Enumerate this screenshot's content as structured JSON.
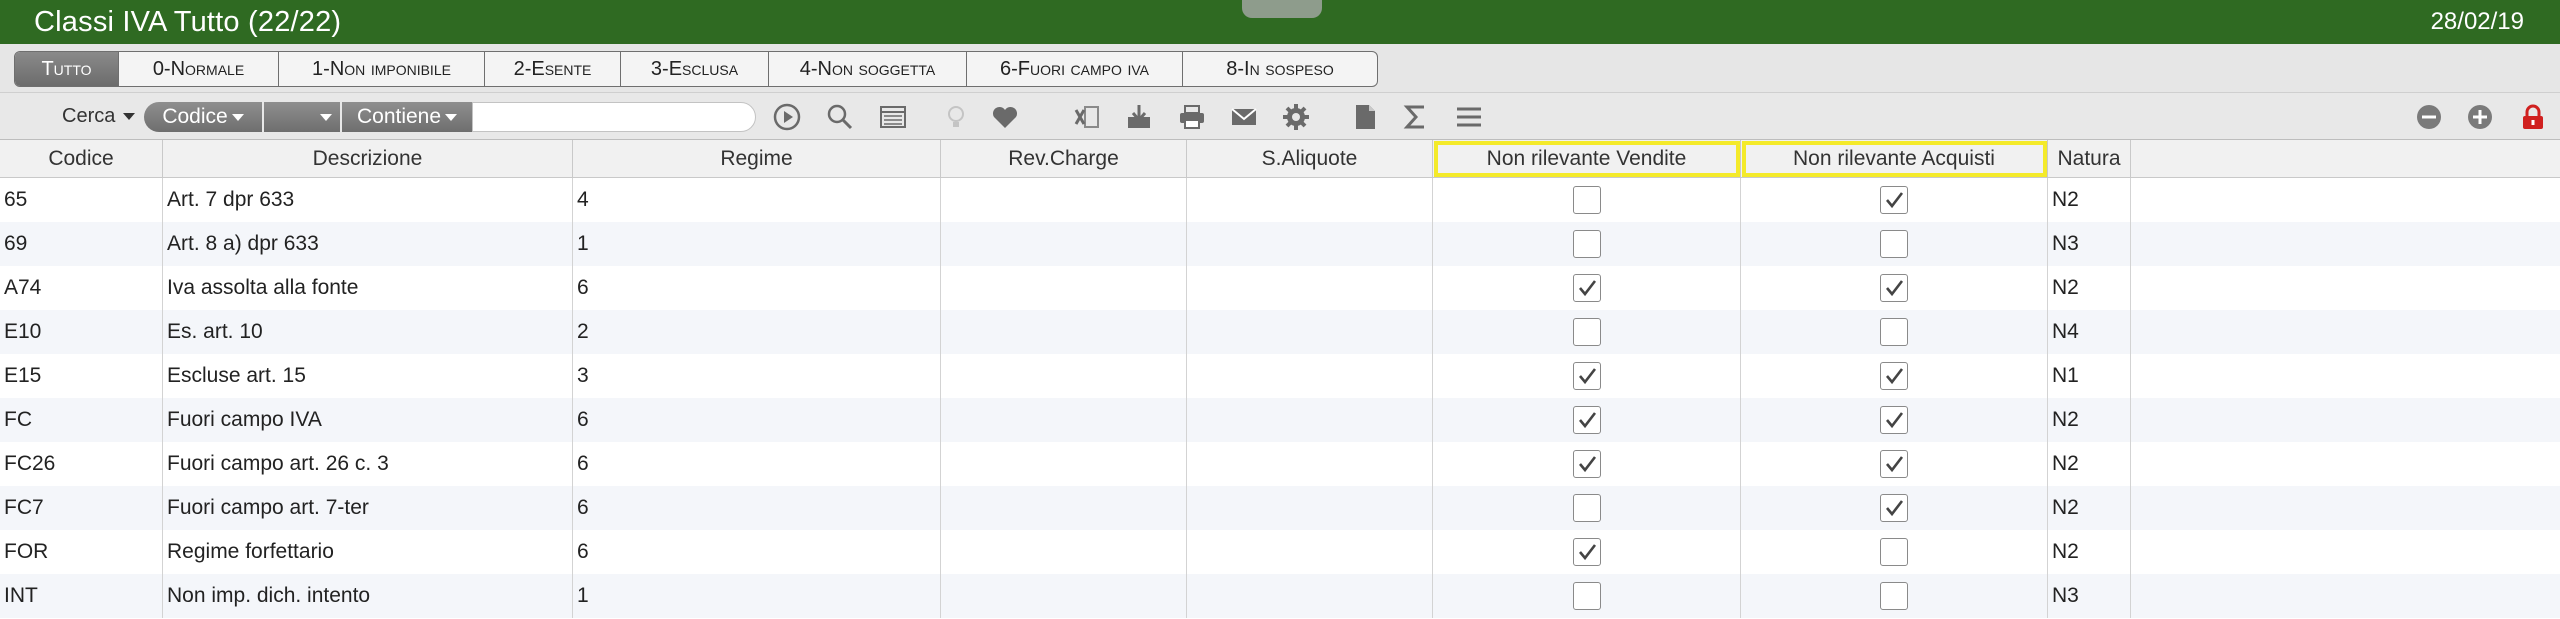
{
  "window": {
    "title": "Classi IVA Tutto (22/22)",
    "date": "28/02/19"
  },
  "tabs": [
    {
      "label": "Tutto",
      "active": true
    },
    {
      "label": "0-Normale",
      "active": false
    },
    {
      "label": "1-Non imponibile",
      "active": false
    },
    {
      "label": "2-Esente",
      "active": false
    },
    {
      "label": "3-Esclusa",
      "active": false
    },
    {
      "label": "4-Non soggetta",
      "active": false
    },
    {
      "label": "6-Fuori campo iva",
      "active": false
    },
    {
      "label": "8-In sospeso",
      "active": false
    }
  ],
  "toolbar": {
    "cerca_label": "Cerca",
    "field_select": "Codice",
    "blank_select": "",
    "operator_select": "Contiene",
    "search_value": "",
    "icons": [
      "play-icon",
      "search-icon",
      "list-view-icon",
      "lightbulb-icon",
      "heart-icon",
      "excel-icon",
      "download-icon",
      "print-icon",
      "mail-icon",
      "gear-icon",
      "document-icon",
      "sum-icon",
      "menu-icon",
      "remove-icon",
      "add-icon",
      "lock-icon"
    ]
  },
  "columns": [
    "Codice",
    "Descrizione",
    "Regime",
    "Rev.Charge",
    "S.Aliquote",
    "Non rilevante Vendite",
    "Non rilevante Acquisti",
    "Natura"
  ],
  "rows": [
    {
      "codice": "65",
      "descrizione": "Art. 7 dpr 633",
      "regime": "4",
      "rev_charge": "",
      "s_aliquote": "",
      "vendite": false,
      "acquisti": true,
      "natura": "N2"
    },
    {
      "codice": "69",
      "descrizione": "Art. 8 a) dpr 633",
      "regime": "1",
      "rev_charge": "",
      "s_aliquote": "",
      "vendite": false,
      "acquisti": false,
      "natura": "N3"
    },
    {
      "codice": "A74",
      "descrizione": "Iva assolta alla fonte",
      "regime": "6",
      "rev_charge": "",
      "s_aliquote": "",
      "vendite": true,
      "acquisti": true,
      "natura": "N2"
    },
    {
      "codice": "E10",
      "descrizione": "Es. art. 10",
      "regime": "2",
      "rev_charge": "",
      "s_aliquote": "",
      "vendite": false,
      "acquisti": false,
      "natura": "N4"
    },
    {
      "codice": "E15",
      "descrizione": "Escluse art. 15",
      "regime": "3",
      "rev_charge": "",
      "s_aliquote": "",
      "vendite": true,
      "acquisti": true,
      "natura": "N1"
    },
    {
      "codice": "FC",
      "descrizione": "Fuori campo IVA",
      "regime": "6",
      "rev_charge": "",
      "s_aliquote": "",
      "vendite": true,
      "acquisti": true,
      "natura": "N2"
    },
    {
      "codice": "FC26",
      "descrizione": "Fuori campo art. 26 c. 3",
      "regime": "6",
      "rev_charge": "",
      "s_aliquote": "",
      "vendite": true,
      "acquisti": true,
      "natura": "N2"
    },
    {
      "codice": "FC7",
      "descrizione": "Fuori campo art. 7-ter",
      "regime": "6",
      "rev_charge": "",
      "s_aliquote": "",
      "vendite": false,
      "acquisti": true,
      "natura": "N2"
    },
    {
      "codice": "FOR",
      "descrizione": "Regime forfettario",
      "regime": "6",
      "rev_charge": "",
      "s_aliquote": "",
      "vendite": true,
      "acquisti": false,
      "natura": "N2"
    },
    {
      "codice": "INT",
      "descrizione": "Non imp. dich. intento",
      "regime": "1",
      "rev_charge": "",
      "s_aliquote": "",
      "vendite": false,
      "acquisti": false,
      "natura": "N3"
    }
  ]
}
